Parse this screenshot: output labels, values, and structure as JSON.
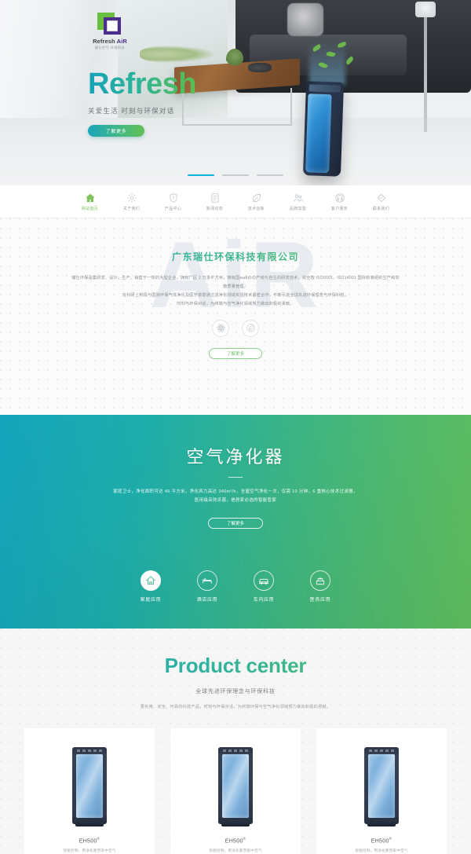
{
  "brand": {
    "logo_text_main": "Refresh",
    "logo_text_accent": "AiR",
    "logo_sub": "瑞仕空气 环保科技"
  },
  "hero": {
    "title": "Refresh",
    "subtitle": "关爱生活 时刻与环保对话",
    "cta_label": "了解更多",
    "slides": [
      "1",
      "2",
      "3"
    ],
    "active_slide": 1,
    "accent_color": "#11b4d6"
  },
  "nav": {
    "items": [
      {
        "label": "网站首页",
        "icon": "home-icon",
        "active": true
      },
      {
        "label": "关于我们",
        "icon": "gear-icon",
        "active": false
      },
      {
        "label": "产品中心",
        "icon": "shield-icon",
        "active": false
      },
      {
        "label": "新闻动态",
        "icon": "document-icon",
        "active": false
      },
      {
        "label": "技术创新",
        "icon": "leaf-icon",
        "active": false
      },
      {
        "label": "品牌加盟",
        "icon": "people-icon",
        "active": false
      },
      {
        "label": "客户服务",
        "icon": "headset-icon",
        "active": false
      },
      {
        "label": "联系我们",
        "icon": "chat-icon",
        "active": false
      }
    ]
  },
  "about": {
    "watermark": "AiR",
    "title": "广东瑞仕环保科技有限公司",
    "paragraph_1": "瑞仕环保是集研发、设计、生产、销售于一体的大型企业，拥有厂区 2 万多平方米，拥有国ныйのの产线与自主的研发技术，完全按 ISO9001、ISO14001 国际标准组织生产和实施质量管理。",
    "paragraph_2": "在科研上积极与国际环保气体净化及医学装置通过滤净化领域实验技术紧密合作，不断引进全球先进环保理念与环保科技，",
    "paragraph_3": "时刻与环保对话，为终端与空气净化领域努力做出积极的贡献。",
    "icons": [
      "atom-icon",
      "leaf-circle-icon"
    ],
    "cta_label": "了解更多"
  },
  "banner": {
    "title": "空气净化器",
    "desc_line_1": "家庭卫士，净化面积可达 45 平方米，净化风力高达 340m³/h，全屋空气净化一次，仅需 10 分钟，6 重核心技术过滤器，",
    "desc_line_2": "医用级高效杀菌，是居家必选的智能管家",
    "cta_label": "了解更多",
    "apps": [
      {
        "label": "家庭应用",
        "icon": "home-icon",
        "active": true
      },
      {
        "label": "酒店应用",
        "icon": "bed-icon",
        "active": false
      },
      {
        "label": "车内应用",
        "icon": "car-icon",
        "active": false
      },
      {
        "label": "医务应用",
        "icon": "medical-icon",
        "active": false
      }
    ],
    "gradient_from": "#0fa9c3",
    "gradient_to": "#63c358"
  },
  "products": {
    "title": "Product center",
    "subtitle": "全球先进环保理念与环保科技",
    "description": "更实用、安全、可靠的科技产品，时刻与环保对话，为终端环保与空气净化领域努力做出积极的贡献。",
    "cards": [
      {
        "name": "EH500",
        "mark": "®",
        "note": "智能控制，用净化重塑家中空气"
      },
      {
        "name": "EH500",
        "mark": "®",
        "note": "智能控制，用净化重塑家中空气"
      },
      {
        "name": "EH500",
        "mark": "®",
        "note": "智能控制，用净化重塑家中空气"
      }
    ]
  }
}
